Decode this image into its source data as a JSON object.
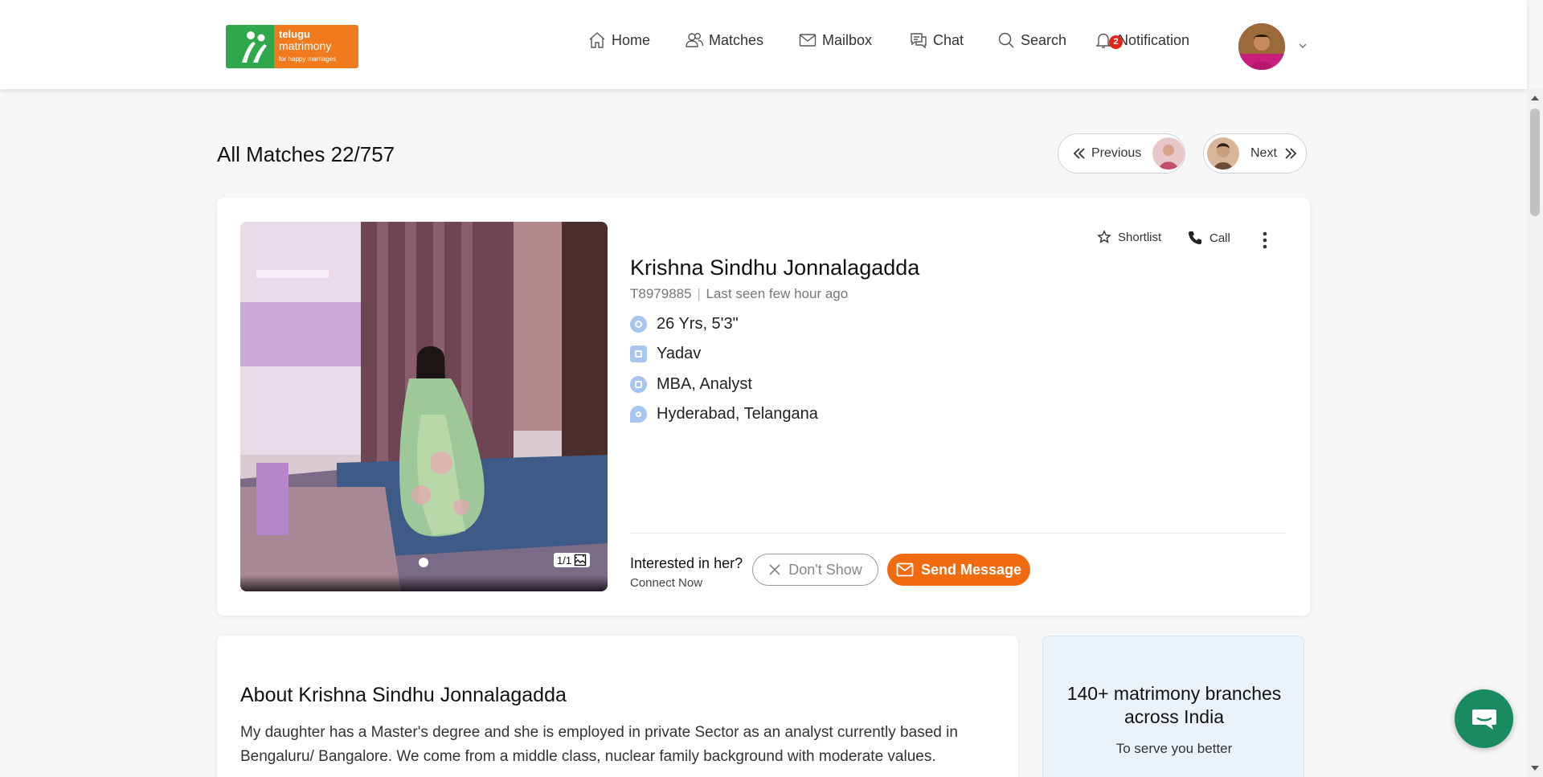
{
  "brand": {
    "line1": "telugu",
    "line2": "matrimony",
    "tagline": "for happy marriages"
  },
  "nav": {
    "home": "Home",
    "matches": "Matches",
    "mailbox": "Mailbox",
    "chat": "Chat",
    "search": "Search",
    "notification": "Notification",
    "notification_count": "2"
  },
  "header": {
    "title": "All Matches 22/757",
    "previous_label": "Previous",
    "next_label": "Next"
  },
  "profile": {
    "name": "Krishna Sindhu Jonnalagadda",
    "id": "T8979885",
    "separator": "|",
    "last_seen": "Last seen few hour ago",
    "age_height": "26 Yrs, 5'3\"",
    "caste": "Yadav",
    "education_job": "MBA, Analyst",
    "location": "Hyderabad, Telangana",
    "photo_counter": "1/1",
    "actions": {
      "shortlist": "Shortlist",
      "call": "Call"
    },
    "interest_question": "Interested in her?",
    "interest_sub": "Connect Now",
    "dont_show_label": "Don't Show",
    "send_message_label": "Send Message"
  },
  "about": {
    "title": "About Krishna Sindhu Jonnalagadda",
    "text": "My daughter has a Master's degree and she is employed in private Sector as an analyst currently based in Bengaluru/ Bangalore. We come from a middle class, nuclear family background with moderate values."
  },
  "branches": {
    "headline": "140+ matrimony branches across India",
    "subline": "To serve you better"
  },
  "colors": {
    "accent": "#f06a0f",
    "brand_green": "#2ea84a",
    "chat_fab": "#1a8a61",
    "notification_badge": "#e2231a"
  },
  "icons": [
    "home-icon",
    "matches-icon",
    "mailbox-icon",
    "chat-icon",
    "search-icon",
    "bell-icon",
    "star-icon",
    "phone-icon",
    "more-vertical-icon",
    "close-icon",
    "mail-icon",
    "chat-bubble-icon"
  ]
}
